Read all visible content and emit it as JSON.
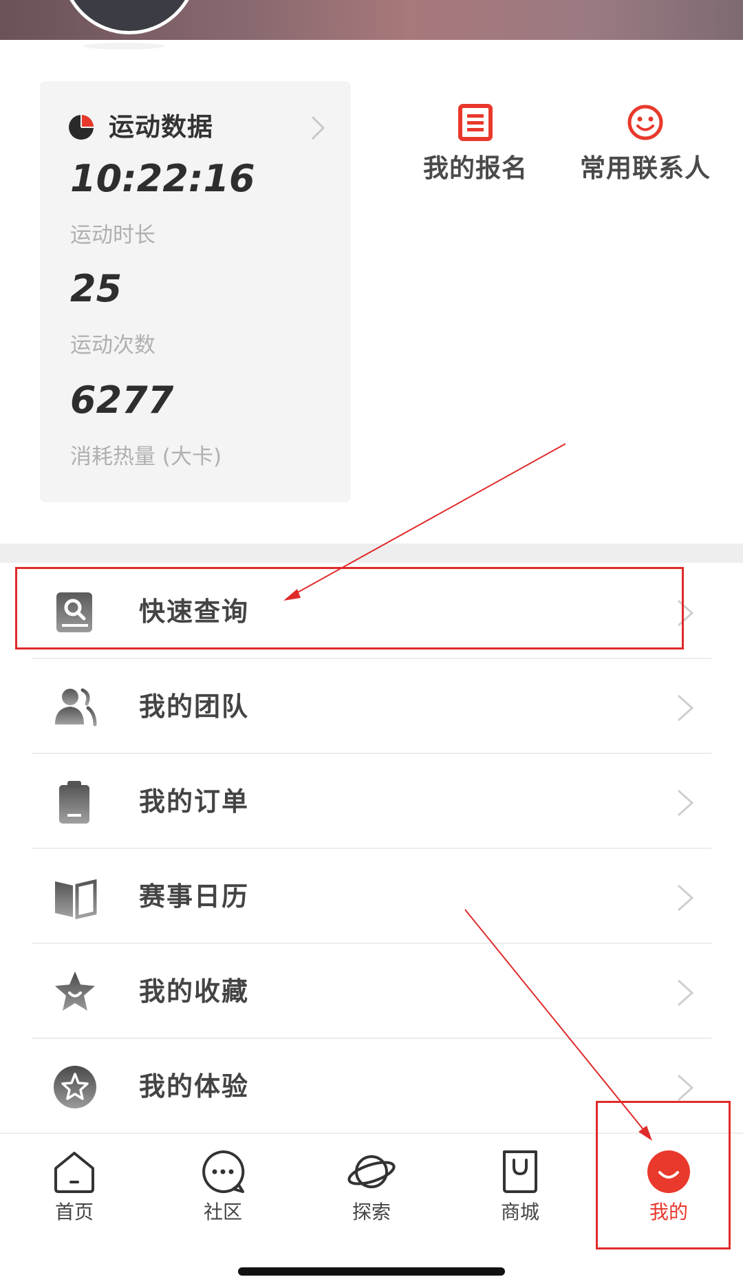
{
  "stats": {
    "title": "运动数据",
    "duration_value": "10:22:16",
    "duration_label": "运动时长",
    "count_value": "25",
    "count_label": "运动次数",
    "calories_value": "6277",
    "calories_label": "消耗热量 (大卡)"
  },
  "quick_actions": {
    "signup_label": "我的报名",
    "contacts_label": "常用联系人"
  },
  "menu": {
    "items": [
      {
        "label": "快速查询",
        "icon": "search-doc-icon"
      },
      {
        "label": "我的团队",
        "icon": "team-icon"
      },
      {
        "label": "我的订单",
        "icon": "clipboard-icon"
      },
      {
        "label": "赛事日历",
        "icon": "book-icon"
      },
      {
        "label": "我的收藏",
        "icon": "star-icon"
      },
      {
        "label": "我的体验",
        "icon": "star-circle-icon"
      }
    ]
  },
  "nav": {
    "items": [
      {
        "label": "首页",
        "icon": "home-icon"
      },
      {
        "label": "社区",
        "icon": "chat-icon"
      },
      {
        "label": "探索",
        "icon": "planet-icon"
      },
      {
        "label": "商城",
        "icon": "shopping-bag-icon"
      },
      {
        "label": "我的",
        "icon": "profile-smile-icon",
        "active": true
      }
    ]
  },
  "colors": {
    "accent": "#e8392c",
    "annotation": "#e02a2a",
    "card_bg": "#f4f4f4"
  }
}
